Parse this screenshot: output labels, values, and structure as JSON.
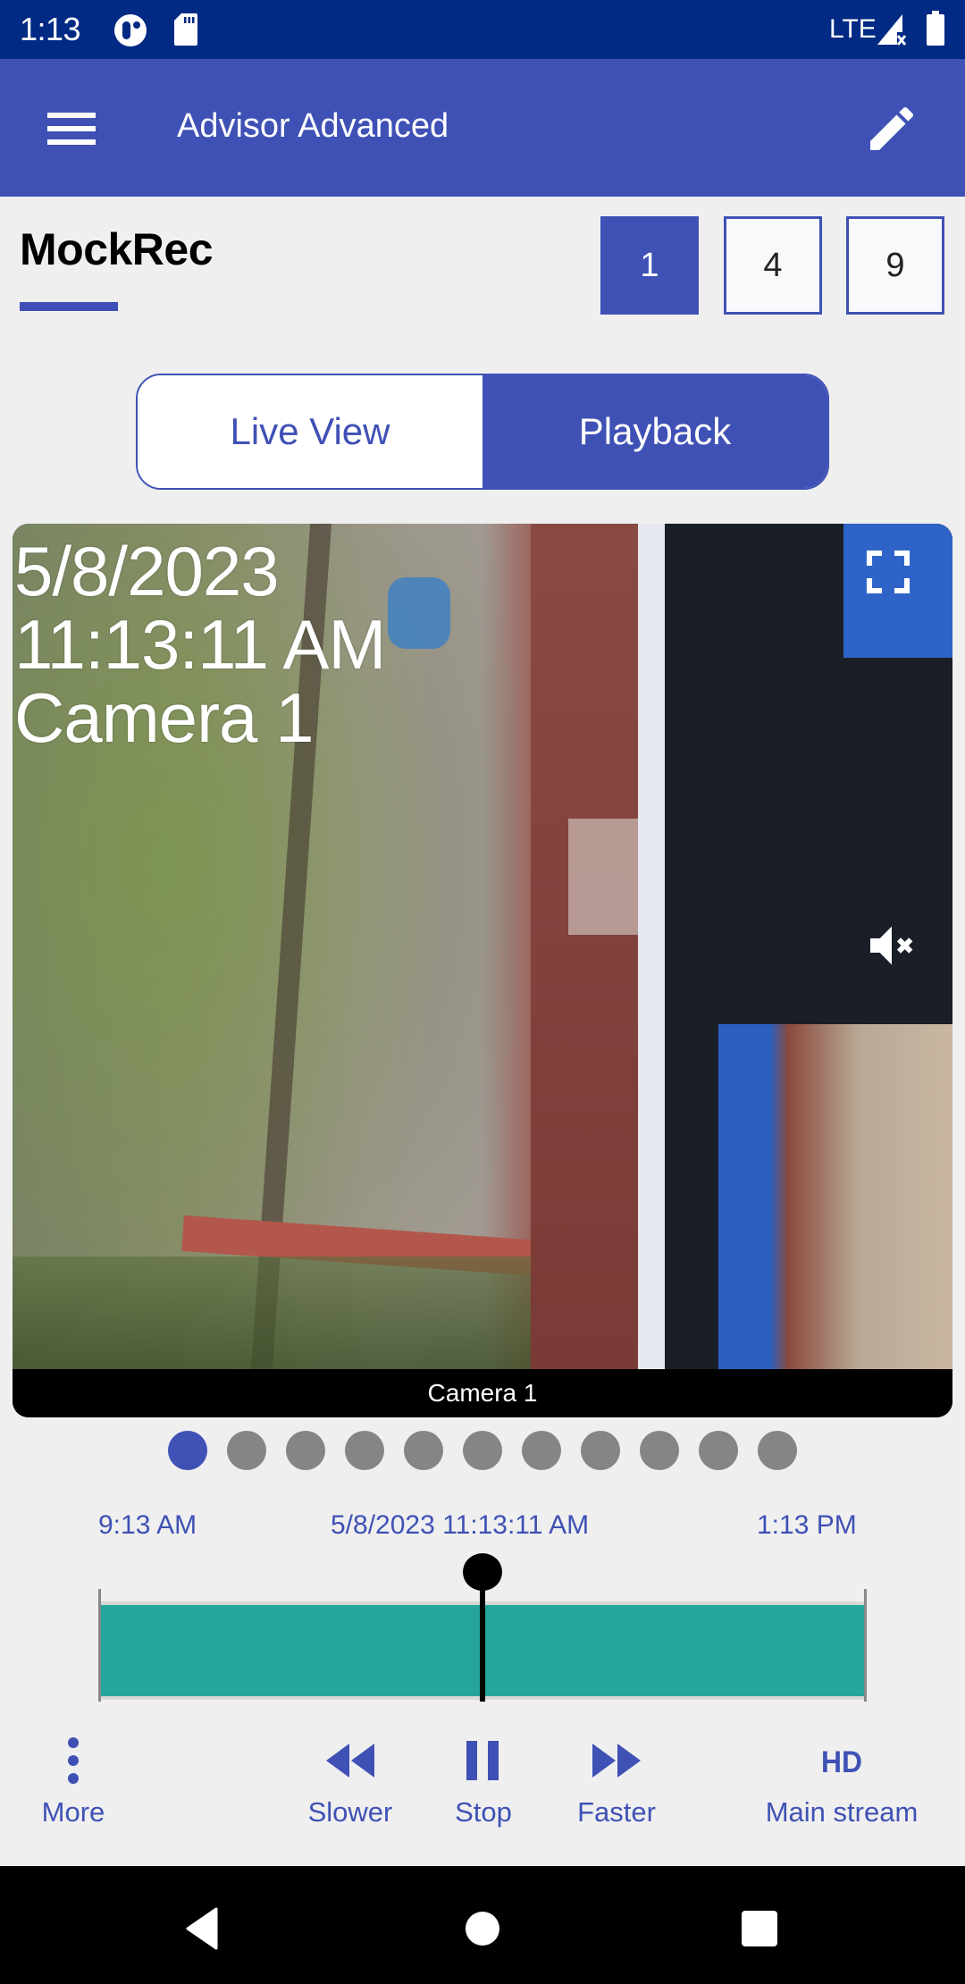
{
  "status_bar": {
    "time": "1:13",
    "network": "LTE",
    "icons": [
      "notification-app-icon",
      "sd-card-icon",
      "signal-no-service-icon",
      "battery-icon"
    ]
  },
  "app_bar": {
    "title": "Advisor Advanced",
    "menu_icon": "hamburger-menu-icon",
    "edit_icon": "pencil-edit-icon"
  },
  "recorder": {
    "name": "MockRec"
  },
  "grid_layouts": [
    {
      "label": "1",
      "active": true
    },
    {
      "label": "4",
      "active": false
    },
    {
      "label": "9",
      "active": false
    }
  ],
  "view_mode": {
    "options": [
      {
        "label": "Live View",
        "active": false
      },
      {
        "label": "Playback",
        "active": true
      }
    ]
  },
  "video": {
    "overlay_date": "5/8/2023",
    "overlay_time": "11:13:11 AM",
    "overlay_camera": "Camera 1",
    "caption": "Camera 1",
    "fullscreen_icon": "fullscreen-icon",
    "audio_icon": "volume-muted-icon",
    "muted": true
  },
  "pager": {
    "total_pages": 11,
    "current_page": 1
  },
  "timeline": {
    "start_label": "9:13 AM",
    "current_label": "5/8/2023 11:13:11 AM",
    "end_label": "1:13 PM",
    "playhead_fraction": 0.5,
    "recording_color": "#26a69a"
  },
  "controls": [
    {
      "id": "more",
      "label": "More",
      "icon": "more-vertical-icon"
    },
    {
      "id": "slower",
      "label": "Slower",
      "icon": "rewind-icon"
    },
    {
      "id": "stop",
      "label": "Stop",
      "icon": "pause-icon"
    },
    {
      "id": "faster",
      "label": "Faster",
      "icon": "fast-forward-icon"
    },
    {
      "id": "stream",
      "label": "Main stream",
      "icon": "hd-icon"
    }
  ],
  "nav_bar": {
    "buttons": [
      "back-icon",
      "home-icon",
      "recents-icon"
    ]
  },
  "colors": {
    "primary": "#3f51b5",
    "status_bar": "#002a83",
    "background": "#efefef",
    "inactive_dot": "#858585"
  }
}
